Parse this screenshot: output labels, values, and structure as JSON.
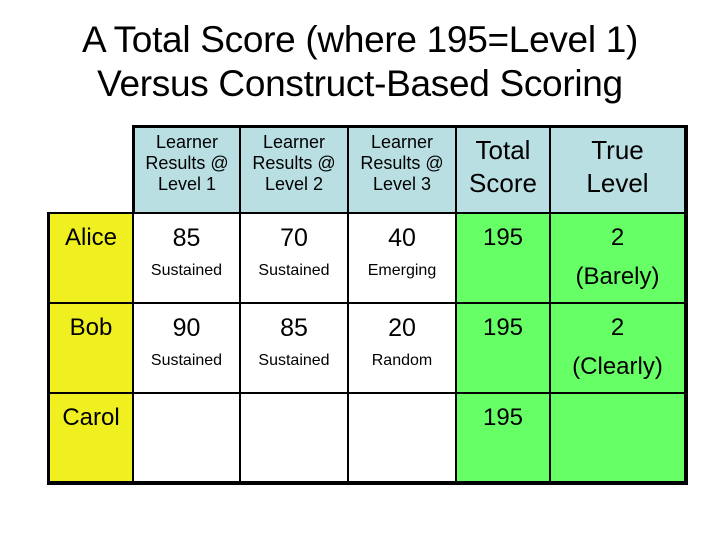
{
  "title": {
    "line1": "A Total Score (where 195=Level 1)",
    "line2": "Versus Construct-Based Scoring"
  },
  "table": {
    "headers": [
      {
        "line1": "Learner",
        "line2": "Results @",
        "line3": "Level 1"
      },
      {
        "line1": "Learner",
        "line2": "Results @",
        "line3": "Level 2"
      },
      {
        "line1": "Learner",
        "line2": "Results @",
        "line3": "Level 3"
      },
      {
        "line1": "Total",
        "line2": "Score"
      },
      {
        "line1": "True",
        "line2": "Level"
      }
    ],
    "rows": [
      {
        "name": "Alice",
        "levels": [
          {
            "score": "85",
            "label": "Sustained"
          },
          {
            "score": "70",
            "label": "Sustained"
          },
          {
            "score": "40",
            "label": "Emerging"
          }
        ],
        "total": "195",
        "true_level": {
          "value": "2",
          "qualifier": "(Barely)"
        }
      },
      {
        "name": "Bob",
        "levels": [
          {
            "score": "90",
            "label": "Sustained"
          },
          {
            "score": "85",
            "label": "Sustained"
          },
          {
            "score": "20",
            "label": "Random"
          }
        ],
        "total": "195",
        "true_level": {
          "value": "2",
          "qualifier": "(Clearly)"
        }
      },
      {
        "name": "Carol",
        "levels": [
          {
            "score": "",
            "label": ""
          },
          {
            "score": "",
            "label": ""
          },
          {
            "score": "",
            "label": ""
          }
        ],
        "total": "195",
        "true_level": {
          "value": "",
          "qualifier": ""
        }
      }
    ]
  },
  "colors": {
    "header_bg": "#b9dfe3",
    "name_bg": "#f0f020",
    "result_bg": "#66ff66",
    "data_bg": "#ffffff"
  }
}
